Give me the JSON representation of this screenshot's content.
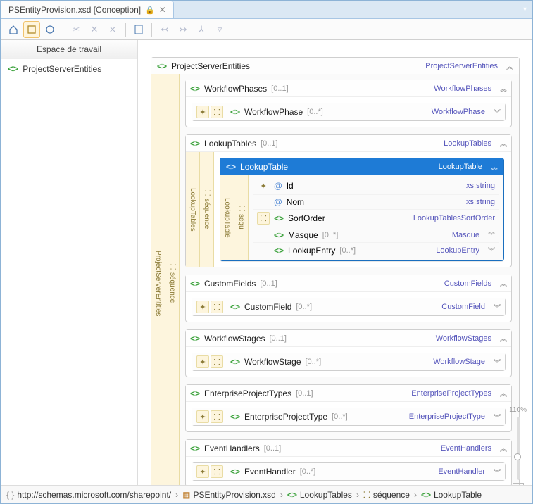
{
  "tab": {
    "title": "PSEntityProvision.xsd [Conception]"
  },
  "sidebar": {
    "header": "Espace de travail",
    "item0": "ProjectServerEntities"
  },
  "root": {
    "name": "ProjectServerEntities",
    "type": "ProjectServerEntities",
    "stripe": "ProjectServerEntities",
    "seq": "séquence"
  },
  "sections": {
    "workflowPhases": {
      "name": "WorkflowPhases",
      "card": "[0..1]",
      "type": "WorkflowPhases",
      "child": {
        "name": "WorkflowPhase",
        "card": "[0..*]",
        "type": "WorkflowPhase"
      }
    },
    "lookupTables": {
      "name": "LookupTables",
      "card": "[0..1]",
      "type": "LookupTables",
      "stripe": "LookupTables",
      "seq": "séquence",
      "child": {
        "name": "LookupTable",
        "type": "LookupTable",
        "stripe": "LookupTable",
        "seq": "séqu",
        "attrs": [
          {
            "icon": "@",
            "name": "Id",
            "type": "xs:string"
          },
          {
            "icon": "@",
            "name": "Nom",
            "type": "xs:string"
          },
          {
            "icon": "<>",
            "name": "SortOrder",
            "type": "LookupTablesSortOrder"
          },
          {
            "icon": "<>",
            "name": "Masque",
            "card": "[0..*]",
            "type": "Masque"
          },
          {
            "icon": "<>",
            "name": "LookupEntry",
            "card": "[0..*]",
            "type": "LookupEntry"
          }
        ]
      }
    },
    "customFields": {
      "name": "CustomFields",
      "card": "[0..1]",
      "type": "CustomFields",
      "child": {
        "name": "CustomField",
        "card": "[0..*]",
        "type": "CustomField"
      }
    },
    "workflowStages": {
      "name": "WorkflowStages",
      "card": "[0..1]",
      "type": "WorkflowStages",
      "child": {
        "name": "WorkflowStage",
        "card": "[0..*]",
        "type": "WorkflowStage"
      }
    },
    "enterpriseProjectTypes": {
      "name": "EnterpriseProjectTypes",
      "card": "[0..1]",
      "type": "EnterpriseProjectTypes",
      "child": {
        "name": "EnterpriseProjectType",
        "card": "[0..*]",
        "type": "EnterpriseProjectType"
      }
    },
    "eventHandlers": {
      "name": "EventHandlers",
      "card": "[0..1]",
      "type": "EventHandlers",
      "child": {
        "name": "EventHandler",
        "card": "[0..*]",
        "type": "EventHandler"
      }
    }
  },
  "zoom": "110%",
  "breadcrumb": {
    "ns": "http://schemas.microsoft.com/sharepoint/",
    "file": "PSEntityProvision.xsd",
    "p2": "LookupTables",
    "p3": "séquence",
    "p4": "LookupTable"
  }
}
